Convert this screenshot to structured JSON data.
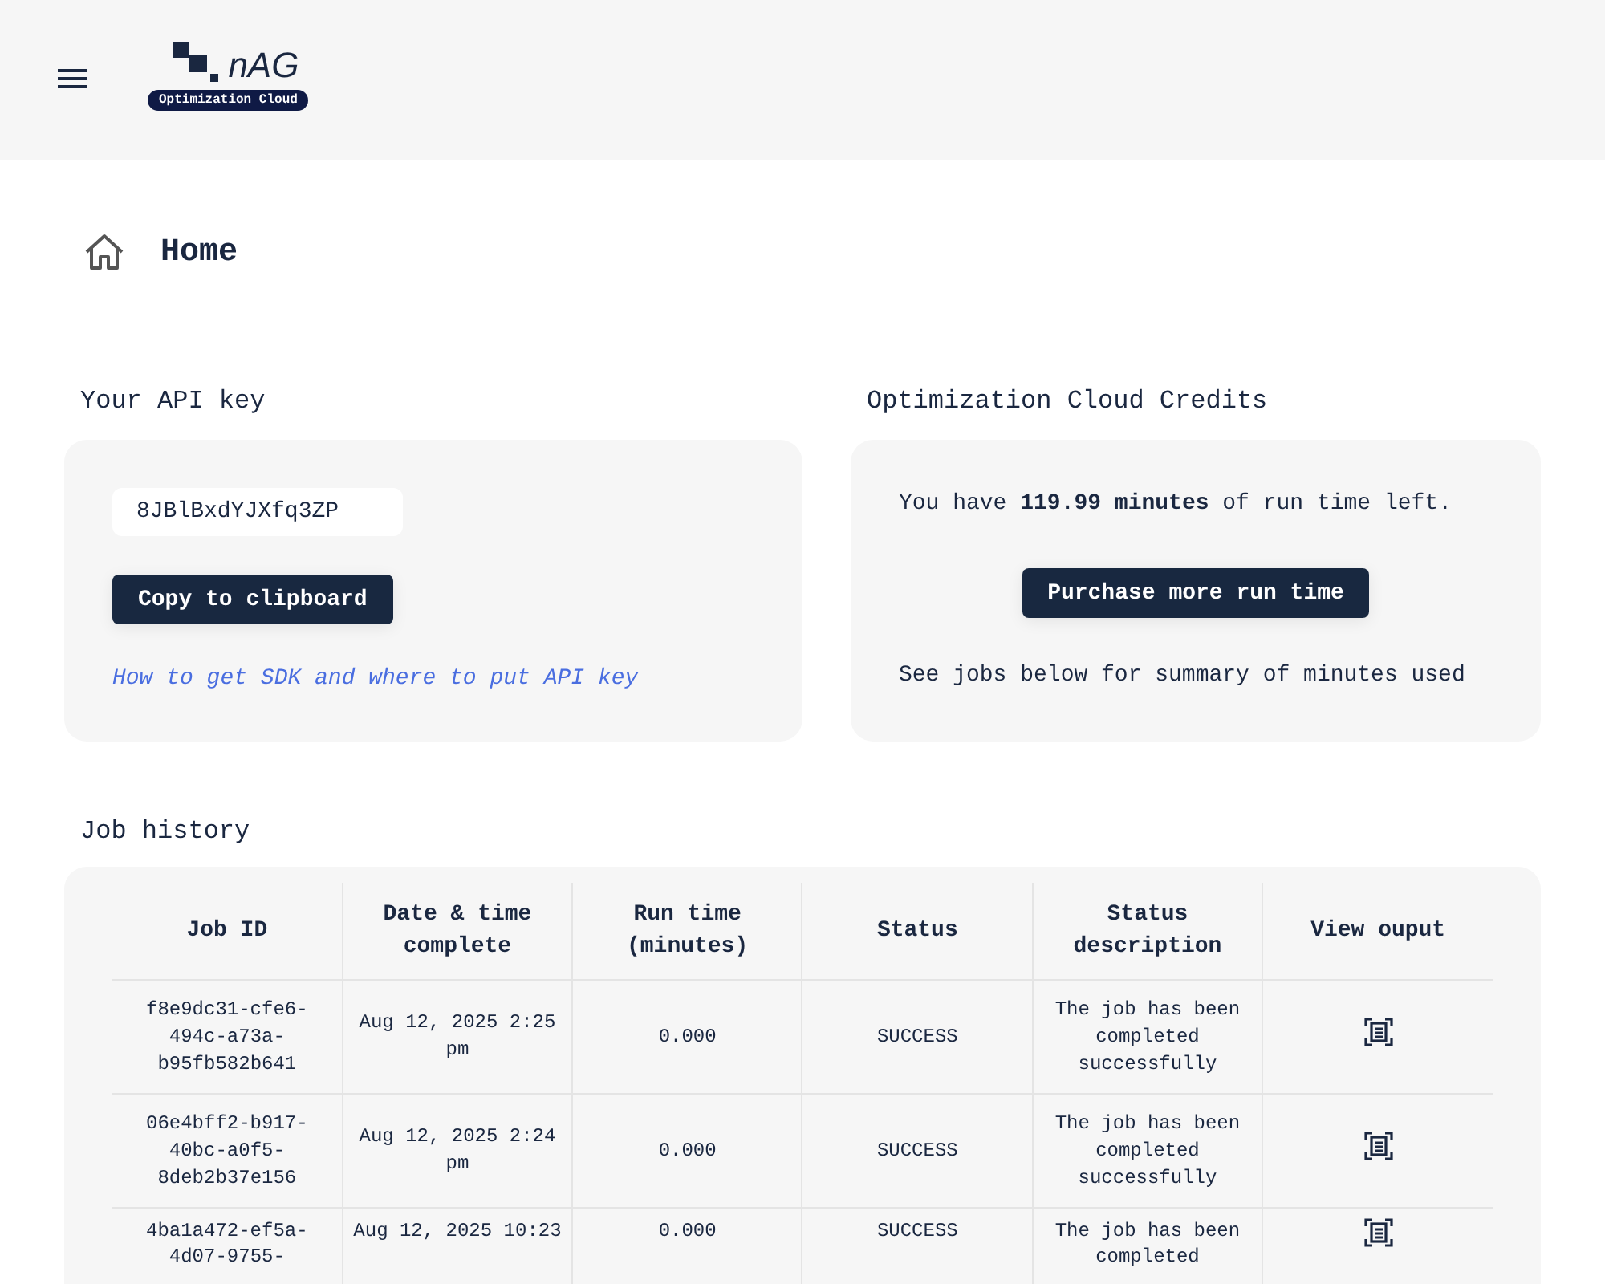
{
  "header": {
    "logo_text": "nAG",
    "logo_badge": "Optimization Cloud"
  },
  "page_title": "Home",
  "api_key": {
    "heading": "Your API key",
    "value": "8JBlBxdYJXfq3ZP",
    "button": "Copy to clipboard",
    "link": "How to get SDK and where to put API key"
  },
  "credits": {
    "heading": "Optimization Cloud Credits",
    "summary": "You have **119.99 minutes** of run time left.",
    "button": "Purchase more run time",
    "note": "See jobs below for summary of minutes used"
  },
  "job_history": {
    "heading": "Job history",
    "columns": [
      "Job ID",
      "Date & time complete",
      "Run time (minutes)",
      "Status",
      "Status description",
      "View ouput"
    ],
    "rows": [
      {
        "job_id": "f8e9dc31-cfe6-494c-a73a-b95fb582b641",
        "date": "Aug 12, 2025 2:25 pm",
        "run_time": "0.000",
        "status": "SUCCESS",
        "description": "The job has been completed successfully"
      },
      {
        "job_id": "06e4bff2-b917-40bc-a0f5-8deb2b37e156",
        "date": "Aug 12, 2025 2:24 pm",
        "run_time": "0.000",
        "status": "SUCCESS",
        "description": "The job has been completed successfully"
      },
      {
        "job_id": "4ba1a472-ef5a-4d07-9755-",
        "date": "Aug 12, 2025 10:23",
        "run_time": "0.000",
        "status": "SUCCESS",
        "description": "The job has been completed"
      }
    ]
  }
}
